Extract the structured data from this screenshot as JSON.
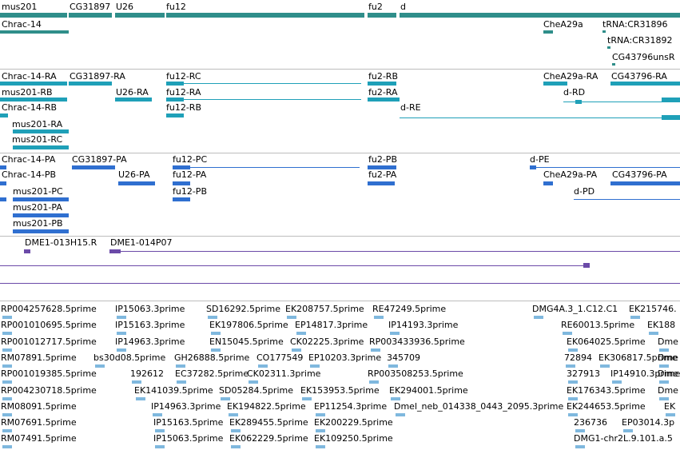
{
  "colors": {
    "gene": "#2f8e8a",
    "mrna_a": "#1fa0b8",
    "mrna_b": "#2f6fd0",
    "clone": "#6b4aa8",
    "est": "#7fb8de",
    "divider": "#bdbdbd"
  },
  "tracks": {
    "genes": {
      "labels": [
        "mus201",
        "CG31897",
        "U26",
        "fu12",
        "fu2",
        "d",
        "Chrac-14",
        "CheA29a",
        "tRNA:CR31896",
        "tRNA:CR31892",
        "CG43796unsR"
      ]
    },
    "transcripts_1": {
      "labels": [
        "Chrac-14-RA",
        "CG31897-RA",
        "fu12-RC",
        "fu2-RB",
        "CheA29a-RA",
        "CG43796-RA",
        "mus201-RB",
        "U26-RA",
        "fu12-RA",
        "fu2-RA",
        "d-RD",
        "Chrac-14-RB",
        "fu12-RB",
        "d-RE",
        "mus201-RA",
        "mus201-RC"
      ]
    },
    "transcripts_2": {
      "labels": [
        "Chrac-14-PA",
        "CG31897-PA",
        "fu12-PC",
        "fu2-PB",
        "d-PE",
        "Chrac-14-PB",
        "U26-PA",
        "fu12-PA",
        "fu2-PA",
        "CheA29a-PA",
        "CG43796-PA",
        "mus201-PC",
        "fu12-PB",
        "d-PD",
        "mus201-PA",
        "mus201-PB"
      ]
    },
    "clones": {
      "labels": [
        "DME1-013H15.R",
        "DME1-014P07"
      ]
    },
    "ests": {
      "rows": [
        [
          "RP004257628.5prime",
          "IP15063.3prime",
          "SD16292.5prime",
          "EK208757.5prime",
          "RE47249.5prime",
          "DMG4A.3_1.C12.C1",
          "EK215746."
        ],
        [
          "RP001010695.5prime",
          "IP15163.3prime",
          "EK197806.5prime",
          "EP14817.3prime",
          "IP14193.3prime",
          "RE60013.5prime",
          "EK188"
        ],
        [
          "RP001012717.5prime",
          "IP14963.3prime",
          "EN15045.5prime",
          "CK02225.3prime",
          "RP003433936.5prime",
          "EK064025.5prime",
          "Dme"
        ],
        [
          "RM07891.5prime",
          "bs30d08.5prime",
          "GH26888.5prime",
          "CO177549",
          "EP10203.3prime",
          "345709",
          "72894",
          "EK306817.5prime",
          "Dme"
        ],
        [
          "RP001019385.5prime",
          "192612",
          "EC37282.5prime",
          "CK02311.3prime",
          "RP003508253.5prime",
          "327913",
          "IP14910.3prime",
          "Dme"
        ],
        [
          "RP004230718.5prime",
          "EK141039.5prime",
          "SD05284.5prime",
          "EK153953.5prime",
          "EK294001.5prime",
          "EK176343.5prime",
          "Dme"
        ],
        [
          "RM08091.5prime",
          "IP14963.3prime",
          "EK194822.5prime",
          "EP11254.3prime",
          "Dmel_neb_014338_0443_2095.3prime",
          "EK244653.5prime",
          "EK"
        ],
        [
          "RM07691.5prime",
          "IP15163.5prime",
          "EK289455.5prime",
          "EK200229.5prime",
          "236736",
          "EP03014.3p"
        ],
        [
          "RM07491.5prime",
          "IP15063.5prime",
          "EK062229.5prime",
          "EK109250.5prime",
          "DMG1-chr2L.9.101.a.5"
        ]
      ]
    }
  }
}
